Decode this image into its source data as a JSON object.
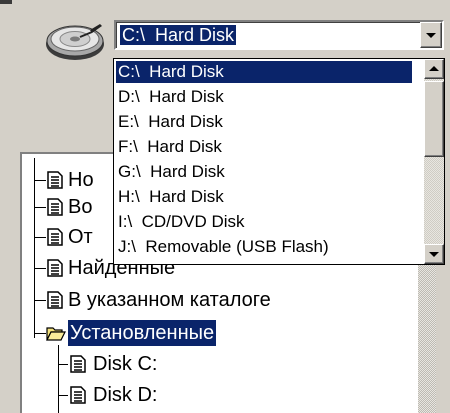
{
  "drive_selector": {
    "selected_value": "C:\\  Hard Disk",
    "icon": "hard-disk-icon"
  },
  "dropdown": {
    "items": [
      {
        "label": "C:\\  Hard Disk",
        "selected": true
      },
      {
        "label": "D:\\  Hard Disk",
        "selected": false
      },
      {
        "label": "E:\\  Hard Disk",
        "selected": false
      },
      {
        "label": "F:\\  Hard Disk",
        "selected": false
      },
      {
        "label": "G:\\  Hard Disk",
        "selected": false
      },
      {
        "label": "H:\\  Hard Disk",
        "selected": false
      },
      {
        "label": "I:\\  CD/DVD Disk",
        "selected": false
      },
      {
        "label": "J:\\  Removable (USB Flash)",
        "selected": false
      }
    ]
  },
  "tree": {
    "nodes": [
      {
        "label": "Но",
        "icon": "document-icon"
      },
      {
        "label": "Во",
        "icon": "document-icon"
      },
      {
        "label": "От",
        "icon": "document-icon"
      },
      {
        "label": "Найденные",
        "icon": "document-icon"
      },
      {
        "label": "В указанном каталоге",
        "icon": "document-icon"
      },
      {
        "label": "Установленные",
        "icon": "open-folder-icon",
        "selected": true
      }
    ],
    "children": [
      {
        "label": "Disk C:",
        "icon": "document-icon"
      },
      {
        "label": "Disk D:",
        "icon": "document-icon"
      }
    ]
  },
  "colors": {
    "face": "#d4d0c8",
    "highlight": "#0a246a",
    "highlight_text": "#ffffff"
  }
}
